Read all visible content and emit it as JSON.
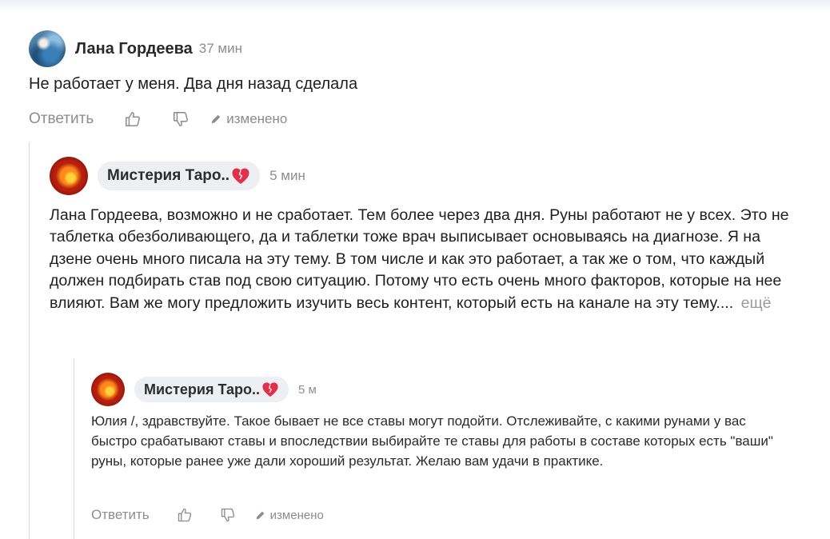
{
  "comment_main": {
    "author": "Лана Гордеева",
    "time": "37 мин",
    "text": "Не работает у меня. Два дня назад сделала",
    "actions": {
      "reply": "Ответить",
      "edited": "изменено"
    }
  },
  "reply_1": {
    "author": "Мистерия Таро..",
    "time": "5 мин",
    "text": "Лана Гордеева, возможно и не сработает. Тем более через два дня. Руны работают не у всех. Это не таблетка обезболивающего, да и таблетки тоже врач выписывает основываясь на диагнозе. Я на дзене очень много писала на эту тему. В том числе и как это работает, а так же о том, что каждый должен подбирать став под свою ситуацию. Потому что есть очень много факторов, которые на нее влияют. Вам же могу предложить изучить весь контент, который есть на канале на эту тему....",
    "more": "ещё"
  },
  "reply_2": {
    "author": "Мистерия Таро..",
    "time": "5 м",
    "text": "Юлия /, здравствуйте. Такое бывает не все ставы могут подойти. Отслеживайте, с какими рунами у вас быстро срабатывают ставы и впоследствии выбирайте те ставы для работы в составе которых есть \"ваши\" руны, которые ранее уже дали хороший результат. Желаю вам удачи в практике.",
    "actions": {
      "reply": "Ответить",
      "edited": "изменено"
    }
  },
  "icons": {
    "like": "thumb-up-icon",
    "dislike": "thumb-down-icon",
    "edited": "pencil-icon",
    "heart": "heart-icon"
  },
  "colors": {
    "heart": "#e0304a",
    "muted_text": "#8d8d8d",
    "pill_background": "#eeeff2"
  }
}
